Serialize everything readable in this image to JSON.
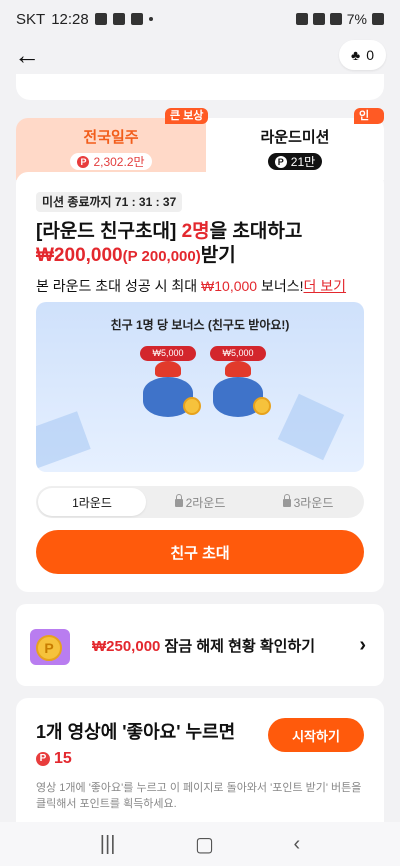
{
  "status": {
    "carrier": "SKT",
    "time": "12:28",
    "battery": "7%"
  },
  "top": {
    "points": "0"
  },
  "tabs": [
    {
      "title": "전국일주",
      "amount": "2,302.2만",
      "badge": "큰 보상"
    },
    {
      "title": "라운드미션",
      "amount": "21만",
      "badge": "인기"
    }
  ],
  "mission": {
    "timer": "미션 종료까지 71 : 31 : 37",
    "title_prefix": "[라운드 친구초대] ",
    "title_count": "2명",
    "title_suffix": "을 초대하고",
    "reward": "₩200,000",
    "reward_points": "(P 200,000)",
    "reward_suffix": "받기",
    "bonus_prefix": "본 라운드 초대 성공 시 최대 ",
    "bonus_amount": "₩10,000",
    "bonus_suffix": " 보너스!",
    "bonus_link": "더 보기",
    "promo_caption": "친구 1명 당 보너스 (친구도 받아요!)",
    "gift_labels": [
      "₩5,000",
      "₩5,000"
    ],
    "rounds": [
      "1라운드",
      "2라운드",
      "3라운드"
    ],
    "cta": "친구 초대"
  },
  "unlock": {
    "amount": "₩250,000",
    "text": " 잠금 해제 현황 확인하기"
  },
  "video": {
    "title": "1개 영상에 '좋아요' 누르면",
    "points": "15",
    "start": "시작하기",
    "desc": "영상 1개에 '좋아요'를 누르고 이 페이지로 돌아와서 '포인트 받기' 버튼을 클릭해서 포인트를 획득하세요."
  }
}
